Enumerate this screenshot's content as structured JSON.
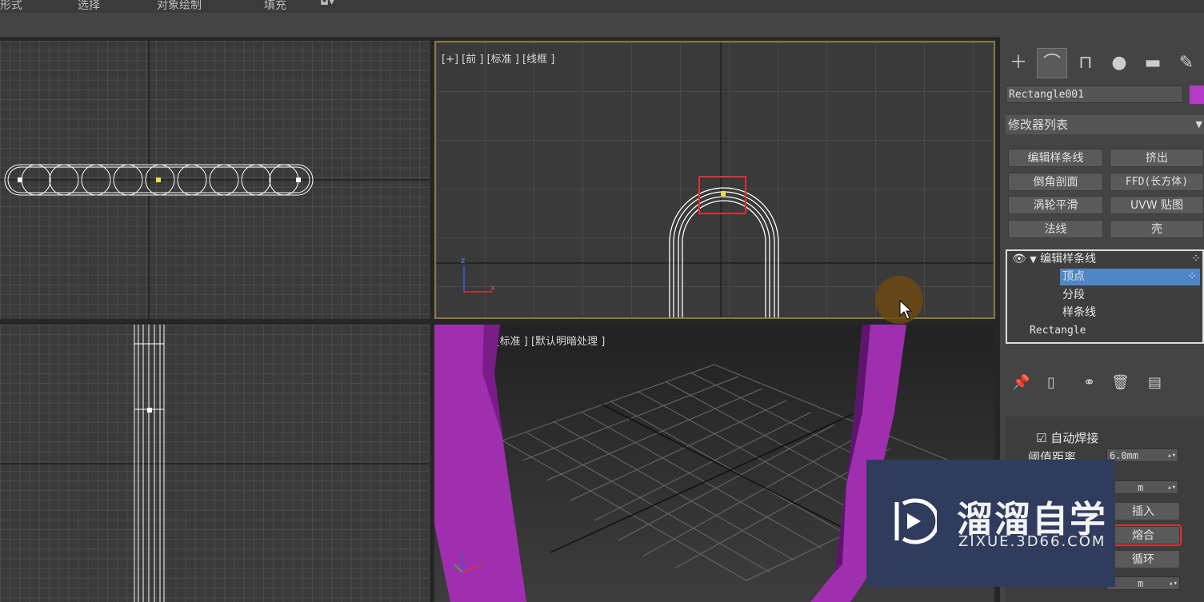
{
  "menubar": {
    "items": [
      "形式",
      "选择",
      "对象绘制",
      "填充"
    ]
  },
  "viewports": {
    "top_left": {
      "label": ""
    },
    "front": {
      "label": "[+] [前 ] [标准 ] [线框 ]"
    },
    "bottom_left": {
      "label": ""
    },
    "perspective": {
      "label": "[+] [透视 ] [标准 ] [默认明暗处理 ]"
    }
  },
  "axis": {
    "z": "z",
    "x": "x",
    "y": "y"
  },
  "panel": {
    "tab_icons": [
      "create-icon",
      "modify-icon",
      "hierarchy-icon",
      "motion-icon",
      "display-icon",
      "utilities-icon"
    ],
    "object_name": "Rectangle001",
    "object_color": "#b43cc8",
    "modifier_list": "修改器列表",
    "modifier_buttons": [
      {
        "label": "编辑样条线"
      },
      {
        "label": "挤出"
      },
      {
        "label": "倒角剖面"
      },
      {
        "label": "FFD(长方体)"
      },
      {
        "label": "涡轮平滑"
      },
      {
        "label": "UVW 贴图"
      },
      {
        "label": "法线"
      },
      {
        "label": "壳"
      }
    ],
    "stack": {
      "modifier": "编辑样条线",
      "sub_vertex": "顶点",
      "sub_segment": "分段",
      "sub_spline": "样条线",
      "base": "Rectangle"
    },
    "rollout": {
      "auto_weld_label": "自动焊接",
      "auto_weld_checked": true,
      "threshold_label": "阈值距离",
      "threshold_value": "6.0mm",
      "spinner2_value": "m",
      "insert_btn": "插入",
      "fuse_btn": "熔合",
      "cycle_btn": "循环",
      "spinner3_value": "m"
    }
  },
  "watermark": {
    "title": "溜溜自学",
    "url": "ZIXUE.3D66.COM"
  }
}
